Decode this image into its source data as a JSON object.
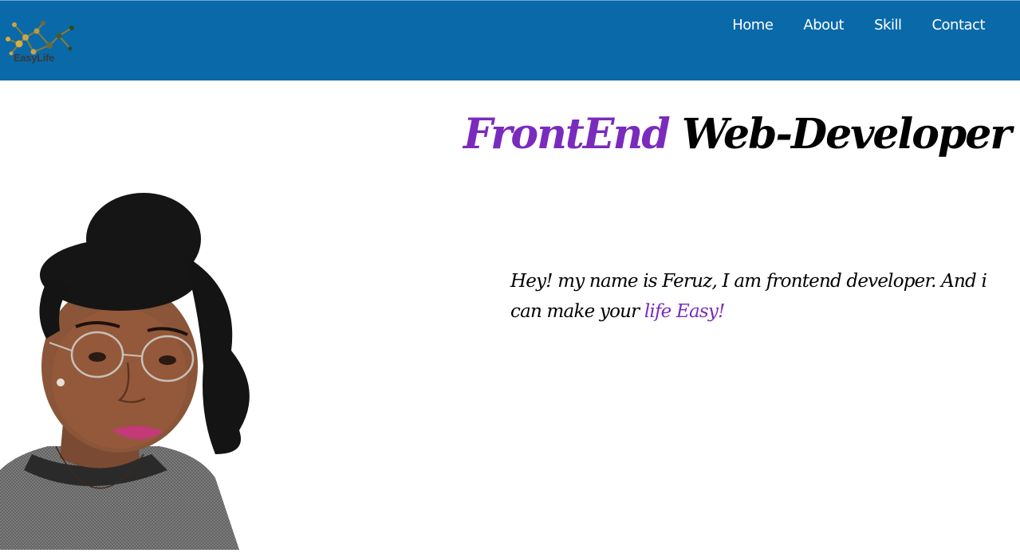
{
  "header": {
    "logo_text": "EasyLife",
    "nav": [
      {
        "label": "Home"
      },
      {
        "label": "About"
      },
      {
        "label": "Skill"
      },
      {
        "label": "Contact"
      }
    ]
  },
  "hero": {
    "title_accent": "FrontEnd",
    "title_rest": "Web-Developer",
    "intro_text": "Hey! my name is Feruz, I am frontend developer. And i can make your ",
    "intro_accent": "life Easy!"
  },
  "colors": {
    "navbar": "#0a69a8",
    "accent": "#7a2bbd",
    "text": "#000000",
    "nav_text": "#ffffff"
  },
  "icons": {
    "logo": "network-nodes-icon",
    "portrait": "profile-photo"
  }
}
